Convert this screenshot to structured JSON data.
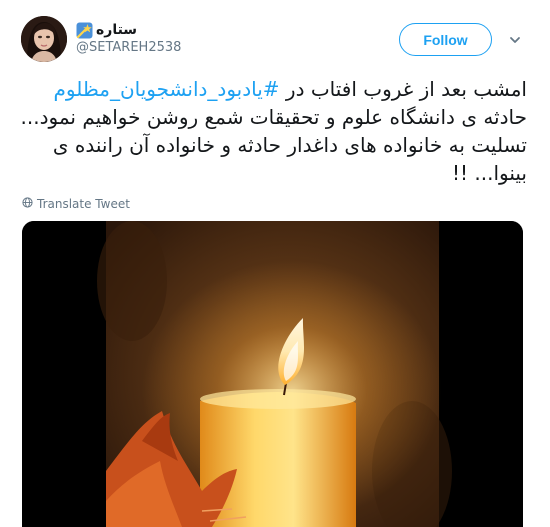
{
  "tweet": {
    "display_name": "ستاره",
    "handle": "@SETAREH2538",
    "follow_label": "Follow",
    "text_line1_prefix": "امشب بعد از غروب افتاب در ",
    "hashtag": "#یادبود_دانشجویان_مظلوم",
    "text_line2": "حادثه ی دانشگاه علوم و تحقیقات شمع روشن خواهیم نمود...",
    "text_line3": "تسلیت به خانواده های داغدار حادثه و خانواده آن راننده ی",
    "text_line4": "بینوا... !!",
    "translate_label": "Translate Tweet"
  },
  "icons": {
    "name_emoji": "shooting-star-icon",
    "more": "chevron-down-icon",
    "translate": "globe-icon"
  },
  "colors": {
    "accent": "#1da1f2",
    "secondary_text": "#657786",
    "primary_text": "#14171a"
  }
}
